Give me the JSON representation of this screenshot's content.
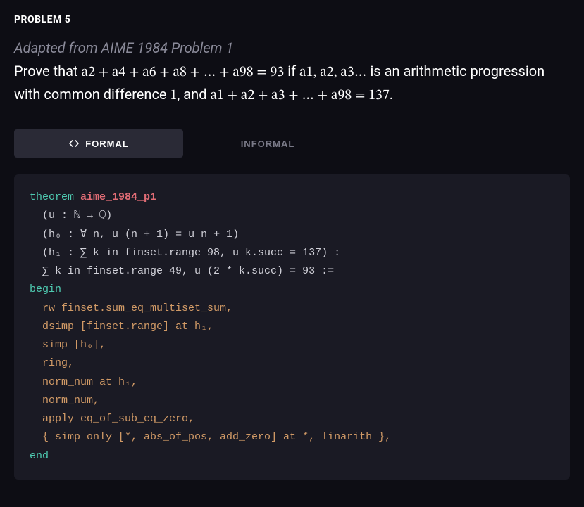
{
  "header": {
    "label": "PROBLEM 5"
  },
  "source": {
    "text": "Adapted from AIME 1984 Problem 1"
  },
  "statement": {
    "pre": "Prove that ",
    "math1": "a2 + a4 + a6 + a8 + … + a98 = 93",
    "mid1": " if ",
    "math2": "a1, a2, a3…",
    "mid2": " is an arithmetic progression with common difference ",
    "math3": "1",
    "mid3": ", and ",
    "math4": "a1 + a2 + a3 + … + a98 = 137",
    "post": "."
  },
  "tabs": {
    "formal": "FORMAL",
    "informal": "INFORMAL"
  },
  "code": {
    "kw_theorem": "theorem",
    "name": "aime_1984_p1",
    "sig1": "  (u : ℕ → ℚ)",
    "sig2": "  (h₀ : ∀ n, u (n + 1) = u n + 1)",
    "sig3": "  (h₁ : ∑ k in finset.range 98, u k.succ = 137) :",
    "sig4": "  ∑ k in finset.range 49, u (2 * k.succ) = 93 :=",
    "kw_begin": "begin",
    "t1": "  rw finset.sum_eq_multiset_sum,",
    "t2": "  dsimp [finset.range] at h₁,",
    "t3": "  simp [h₀],",
    "t4": "  ring,",
    "t5": "  norm_num at h₁,",
    "t6": "  norm_num,",
    "t7": "  apply eq_of_sub_eq_zero,",
    "t8": "  { simp only [*, abs_of_pos, add_zero] at *, linarith },",
    "kw_end": "end"
  }
}
